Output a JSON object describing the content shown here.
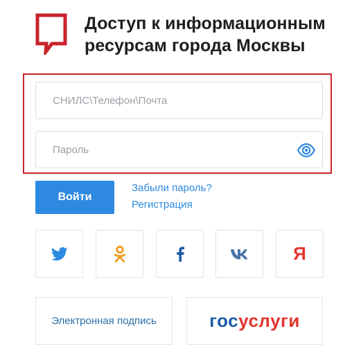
{
  "header": {
    "title_line1": "Доступ к информационным",
    "title_line2": "ресурсам города Москвы",
    "logo_icon": "speech-bubble-logo-icon",
    "logo_color": "#c8232b"
  },
  "form": {
    "login_placeholder": "СНИЛС\\Телефон\\Почта",
    "login_value": "",
    "password_placeholder": "Пароль",
    "password_value": "",
    "show_password_icon": "eye-icon",
    "highlight_color": "#c8232b"
  },
  "actions": {
    "login_button": "Войти",
    "forgot_password": "Забыли пароль?",
    "register": "Регистрация"
  },
  "social": [
    {
      "icon": "twitter-icon",
      "color": "#2d8ae0"
    },
    {
      "icon": "odnoklassniki-icon",
      "color": "#f39a1e"
    },
    {
      "icon": "facebook-icon",
      "color": "#1e5ba8"
    },
    {
      "icon": "vk-icon",
      "color": "#4a76a8"
    },
    {
      "icon": "yandex-icon",
      "color": "#e3342f",
      "glyph": "Я"
    }
  ],
  "alt_login": {
    "esign_label": "Электронная подпись",
    "gosuslugi_part1": "гос",
    "gosuslugi_part2": "услуги"
  },
  "colors": {
    "accent": "#2d8ae0",
    "brand_red": "#c8232b"
  }
}
